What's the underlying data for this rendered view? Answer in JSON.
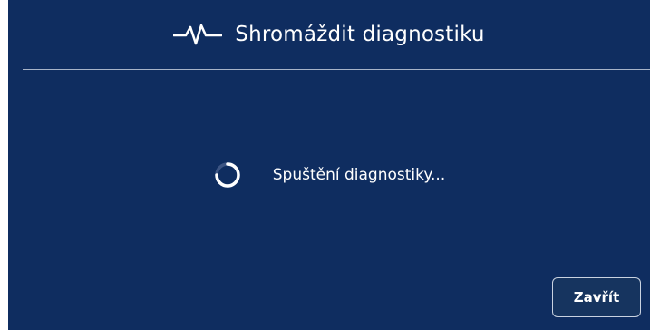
{
  "dialog": {
    "title": "Shromáždit diagnostiku",
    "title_icon": "pulse-icon",
    "status_text": "Spuštění diagnostiky...",
    "status_icon": "spinner-icon",
    "close_label": "Zavřít"
  },
  "colors": {
    "background": "#0f2d60",
    "text": "#ffffff",
    "divider": "#a8b4c8",
    "button_border": "#c9d2e0"
  }
}
